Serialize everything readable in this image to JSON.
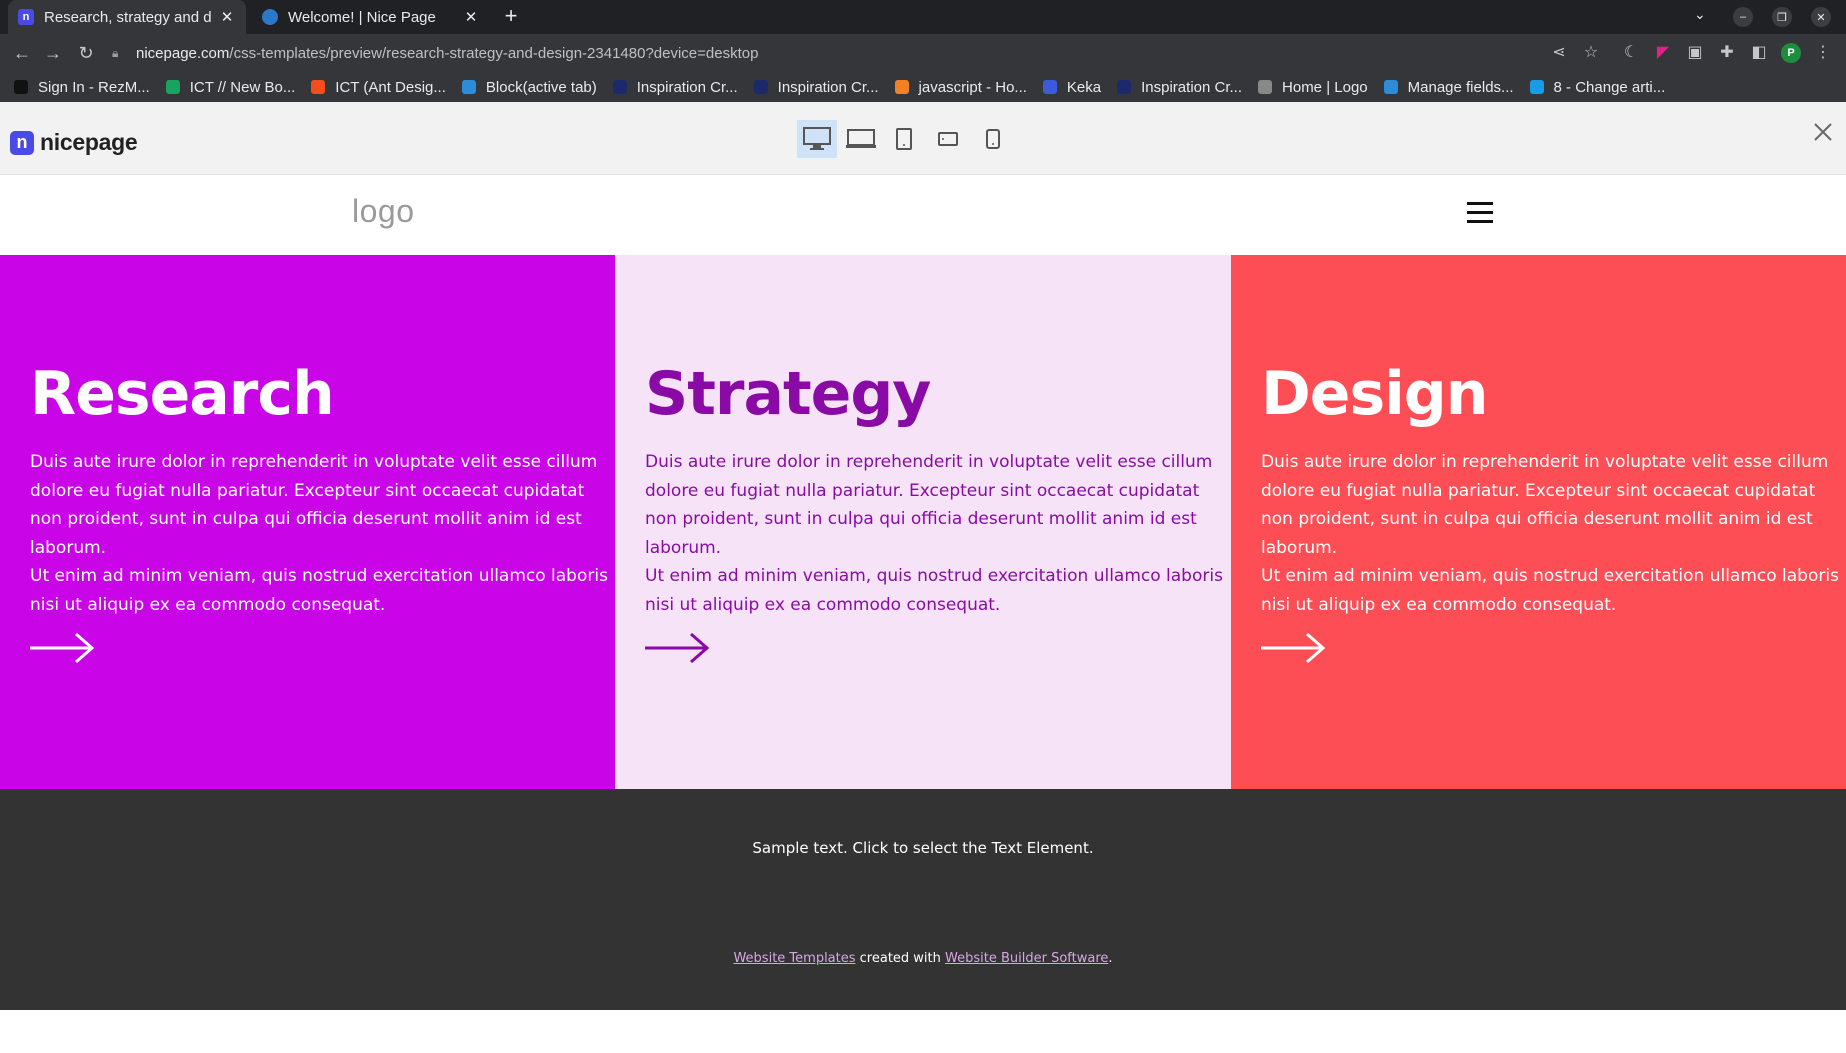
{
  "browser": {
    "tabs": [
      {
        "title": "Research, strategy and de",
        "favicon": "nicepage-favicon",
        "active": true
      },
      {
        "title": "Welcome! | Nice Page",
        "favicon": "drupal-favicon",
        "active": false
      }
    ],
    "new_tab": "+",
    "url_host": "nicepage.com",
    "url_path": "/css-templates/preview/research-strategy-and-design-2341480?device=desktop",
    "profile_initial": "P",
    "bookmarks": [
      {
        "label": "Sign In - RezM...",
        "color": "#111111"
      },
      {
        "label": "ICT // New Bo...",
        "color": "#1aa260"
      },
      {
        "label": "ICT (Ant Desig...",
        "color": "#f24e1e"
      },
      {
        "label": "Block(active tab)",
        "color": "#2e8bd8"
      },
      {
        "label": "Inspiration Cr...",
        "color": "#1c2a6b"
      },
      {
        "label": "Inspiration Cr...",
        "color": "#1c2a6b"
      },
      {
        "label": "javascript - Ho...",
        "color": "#f48024"
      },
      {
        "label": "Keka",
        "color": "#3b5bdb"
      },
      {
        "label": "Inspiration Cr...",
        "color": "#1c2a6b"
      },
      {
        "label": "Home | Logo",
        "color": "#888888"
      },
      {
        "label": "Manage fields...",
        "color": "#2e8bd8"
      },
      {
        "label": "8 - Change arti...",
        "color": "#1a9be6"
      }
    ]
  },
  "nicepage_bar": {
    "logo_text": "nicepage",
    "logo_mark": "n",
    "devices": [
      "desktop-icon",
      "laptop-icon",
      "tablet-icon",
      "tablet-landscape-icon",
      "phone-icon"
    ],
    "active_device": "desktop"
  },
  "site": {
    "logo": "logo",
    "columns": [
      {
        "title": "Research",
        "body_1": "Duis aute irure dolor in reprehenderit in voluptate velit esse cillum dolore eu fugiat nulla pariatur. Excepteur sint occaecat cupidatat non proident, sunt in culpa qui officia deserunt mollit anim id est laborum.",
        "body_2": "Ut enim ad minim veniam, quis nostrud exercitation ullamco laboris nisi ut aliquip ex ea commodo consequat.",
        "bg": "#c904e6",
        "fg": "#ffffff"
      },
      {
        "title": "Strategy",
        "body_1": "Duis aute irure dolor in reprehenderit in voluptate velit esse cillum dolore eu fugiat nulla pariatur. Excepteur sint occaecat cupidatat non proident, sunt in culpa qui officia deserunt mollit anim id est laborum.",
        "body_2": "Ut enim ad minim veniam, quis nostrud exercitation ullamco laboris nisi ut aliquip ex ea commodo consequat.",
        "bg": "#f6e3f8",
        "fg": "#8a0aa6"
      },
      {
        "title": "Design",
        "body_1": "Duis aute irure dolor in reprehenderit in voluptate velit esse cillum dolore eu fugiat nulla pariatur. Excepteur sint occaecat cupidatat non proident, sunt in culpa qui officia deserunt mollit anim id est laborum.",
        "body_2": "Ut enim ad minim veniam, quis nostrud exercitation ullamco laboris nisi ut aliquip ex ea commodo consequat.",
        "bg": "#fe4e55",
        "fg": "#ffffff"
      }
    ],
    "footer": {
      "sample_text": "Sample text. Click to select the Text Element.",
      "link_1": "Website Templates",
      "middle_text": " created with ",
      "link_2": "Website Builder Software",
      "end_text": "."
    }
  }
}
